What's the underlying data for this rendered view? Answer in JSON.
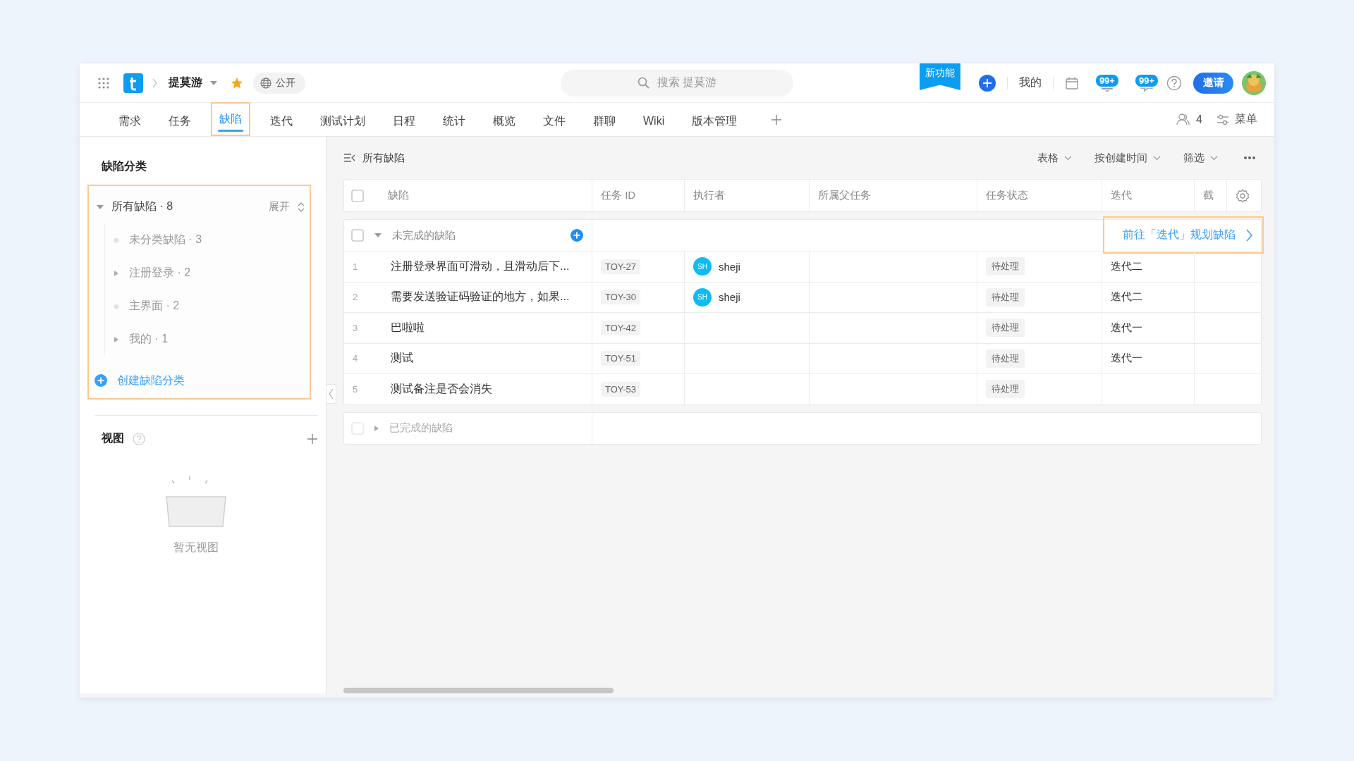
{
  "topbar": {
    "project": "提莫游",
    "starred": true,
    "visibility": "公开",
    "search_placeholder": "搜索 提莫游",
    "new_feature_ribbon": "新功能",
    "my_link": "我的",
    "notifications_badge": "99+",
    "messages_badge": "99+",
    "invite_button": "邀请"
  },
  "tabs": [
    {
      "label": "需求",
      "selected": false,
      "highlighted": false
    },
    {
      "label": "任务",
      "selected": false,
      "highlighted": false
    },
    {
      "label": "缺陷",
      "selected": true,
      "highlighted": true
    },
    {
      "label": "迭代",
      "selected": false,
      "highlighted": false
    },
    {
      "label": "测试计划",
      "selected": false,
      "highlighted": false
    },
    {
      "label": "日程",
      "selected": false,
      "highlighted": false
    },
    {
      "label": "统计",
      "selected": false,
      "highlighted": false
    },
    {
      "label": "概览",
      "selected": false,
      "highlighted": false
    },
    {
      "label": "文件",
      "selected": false,
      "highlighted": false
    },
    {
      "label": "群聊",
      "selected": false,
      "highlighted": false
    },
    {
      "label": "Wiki",
      "selected": false,
      "highlighted": false
    },
    {
      "label": "版本管理",
      "selected": false,
      "highlighted": false
    }
  ],
  "tab_bar_right": {
    "members_count": "4",
    "menu": "菜单"
  },
  "sidebar": {
    "title": "缺陷分类",
    "categories": {
      "highlighted": true,
      "root": {
        "label": "所有缺陷 · 8",
        "expanded": true,
        "children": [
          {
            "label": "未分类缺陷 · 3",
            "expandable": false
          },
          {
            "label": "注册登录 · 2",
            "expandable": true
          },
          {
            "label": "主界面 · 2",
            "expandable": false
          },
          {
            "label": "我的 · 1",
            "expandable": true
          }
        ]
      },
      "expand_toggle": "展开",
      "create_link": "创建缺陷分类"
    },
    "views": {
      "title": "视图",
      "empty_text": "暂无视图"
    }
  },
  "main": {
    "title": "所有缺陷",
    "toolbar": [
      "表格",
      "按创建时间",
      "筛选"
    ],
    "table": {
      "select_all_checked": false,
      "columns": [
        "缺陷",
        "任务 ID",
        "执行者",
        "所属父任务",
        "任务状态",
        "迭代"
      ],
      "column_7": "截",
      "groups": [
        {
          "label": "未完成的缺陷",
          "expanded": true,
          "checked": false,
          "disabled": false,
          "goto_link": {
            "label": "前往「迭代」规划缺陷",
            "highlighted": true
          },
          "rows": [
            {
              "number": "1",
              "title": "注册登录界面可滑动，且滑动后下...",
              "task_id": "TOY-27",
              "assignee": {
                "initials": "SH",
                "name": "sheji"
              },
              "status": "待处理",
              "iteration": "迭代二"
            },
            {
              "number": "2",
              "title": "需要发送验证码验证的地方，如果...",
              "task_id": "TOY-30",
              "assignee": {
                "initials": "SH",
                "name": "sheji"
              },
              "status": "待处理",
              "iteration": "迭代二"
            },
            {
              "number": "3",
              "title": "巴啦啦",
              "task_id": "TOY-42",
              "status": "待处理",
              "iteration": "迭代一"
            },
            {
              "number": "4",
              "title": "测试",
              "task_id": "TOY-51",
              "status": "待处理",
              "iteration": "迭代一"
            },
            {
              "number": "5",
              "title": "测试备注是否会消失",
              "task_id": "TOY-53",
              "status": "待处理"
            }
          ]
        },
        {
          "label": "已完成的缺陷",
          "expanded": false,
          "checked": false,
          "disabled": true
        }
      ]
    }
  }
}
